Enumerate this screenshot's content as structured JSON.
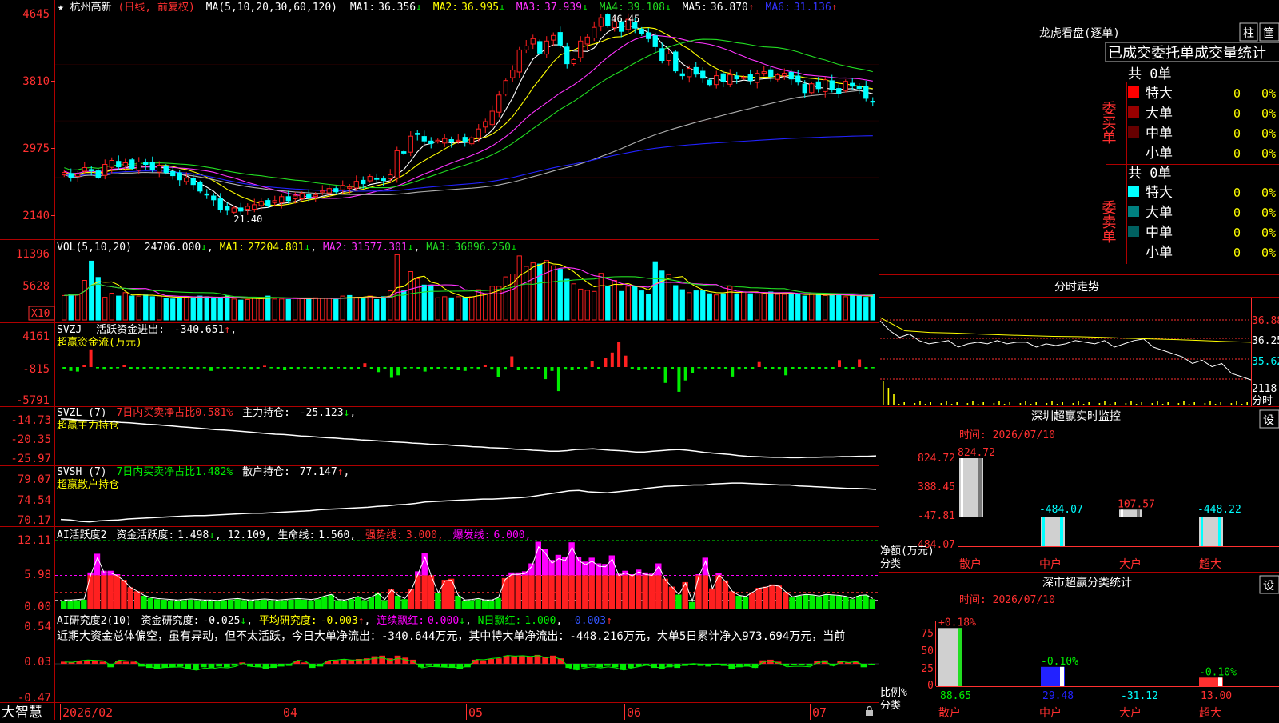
{
  "colors": {
    "bg": "#000000",
    "frame": "#b00000",
    "up": "#ff2020",
    "down": "#00ffff",
    "ma1": "#ffffff",
    "ma2": "#ffff00",
    "ma3": "#ff33ff",
    "ma4": "#22dd22",
    "ma5": "#b0b0b0",
    "ma6": "#2222ff",
    "green": "#00ee00",
    "magenta": "#ff00ff",
    "yellow": "#ffff00",
    "cyan": "#00ffff",
    "white": "#ffffff",
    "red": "#ff3030",
    "gray": "#c0c0c0"
  },
  "price_panel": {
    "star_icon": "★",
    "stock_name": "杭州高新",
    "mode": "(日线, 前复权)",
    "ma_header": "MA(5,10,20,30,60,120)",
    "ma": [
      {
        "label": "MA1:",
        "value": "36.356",
        "arrow": "↓",
        "color": "#ffffff"
      },
      {
        "label": "MA2:",
        "value": "36.995",
        "arrow": "↓",
        "color": "#ffff00"
      },
      {
        "label": "MA3:",
        "value": "37.939",
        "arrow": "↓",
        "color": "#ff33ff"
      },
      {
        "label": "MA4:",
        "value": "39.108",
        "arrow": "↓",
        "color": "#22dd22"
      },
      {
        "label": "MA5:",
        "value": "36.870",
        "arrow": "↑",
        "color": "#ffffff"
      },
      {
        "label": "MA6:",
        "value": "31.136",
        "arrow": "↑",
        "color": "#3333ff"
      }
    ],
    "yticks": [
      "4645",
      "3810",
      "2975",
      "2140"
    ],
    "high_label": "46.45",
    "low_label": "21.40"
  },
  "vol_panel": {
    "header": "VOL(5,10,20)",
    "value": "24706.000",
    "v_arrow": "↓",
    "ma": [
      {
        "label": "MA1:",
        "value": "27204.801",
        "arrow": "↓",
        "color": "#ffff00"
      },
      {
        "label": "MA2:",
        "value": "31577.301",
        "arrow": "↓",
        "color": "#ff33ff"
      },
      {
        "label": "MA3:",
        "value": "36896.250",
        "arrow": "↓",
        "color": "#22dd22"
      }
    ],
    "yticks": [
      "11396",
      "5628"
    ],
    "unit": "X10"
  },
  "svzj_panel": {
    "name": "SVZJ",
    "label": "活跃资金进出:",
    "value": "-340.651",
    "arrow": "↑",
    "sub": "超赢资金流(万元)",
    "yticks": [
      "4161",
      "-815",
      "-5791"
    ]
  },
  "svzl_panel": {
    "name": "SVZL (7)",
    "note": "7日内买卖净占比0.581%",
    "label": "主力持仓:",
    "value": "-25.123",
    "arrow": "↓",
    "sub": "超赢主力持仓",
    "yticks": [
      "-14.73",
      "-20.35",
      "-25.97"
    ]
  },
  "svsh_panel": {
    "name": "SVSH (7)",
    "note": "7日内买卖净占比1.482%",
    "label": "散户持仓:",
    "value": "77.147",
    "arrow": "↑",
    "sub": "超赢散户持仓",
    "yticks": [
      "79.07",
      "74.54",
      "70.17"
    ]
  },
  "ai_panel": {
    "name": "AI活跃度2",
    "l1": "资金活跃度:",
    "v1": "1.498",
    "a1": "↓",
    "v2": "12.109",
    "l3": "生命线:",
    "v3": "1.560",
    "l4": "强势线:",
    "v4": "3.000",
    "l5": "爆发线:",
    "v5": "6.000",
    "yticks": [
      "12.11",
      "5.98",
      "0.00"
    ]
  },
  "ai2_panel": {
    "name": "AI研究度2(10)",
    "l1": "资金研究度:",
    "v1": "-0.025",
    "a1": "↓",
    "l2": "平均研究度:",
    "v2": "-0.003",
    "a2": "↑",
    "l3": "连续飘红:",
    "v3": "0.000",
    "a3": "↓",
    "l4": "N日飘红:",
    "v4": "1.000",
    "v5": "-0.003",
    "a5": "↑",
    "comment": "近期大资金总体偏空，虽有异动，但不太活跃，今日大单净流出：-340.644万元，其中特大单净流出：-448.216万元，大单5日累计净入973.694万元，当前",
    "yticks": [
      "0.54",
      "0.03",
      "-0.47"
    ]
  },
  "bottom_bar": {
    "logo": "大智慧",
    "dates": [
      "2026/02",
      "04",
      "05",
      "06",
      "07"
    ],
    "lock_icon": "lock"
  },
  "dragon": {
    "title": "龙虎看盘(逐单)",
    "btn1": "柱",
    "btn2": "筐",
    "tabs": [
      "已成交",
      "委托单",
      "成交量统计"
    ],
    "buy": {
      "side_label": "委买单",
      "count": "共 0单",
      "rows": [
        {
          "name": "特大",
          "v": "0",
          "p": "0%",
          "color": "#ff0000"
        },
        {
          "name": "大单",
          "v": "0",
          "p": "0%",
          "color": "#990000"
        },
        {
          "name": "中单",
          "v": "0",
          "p": "0%",
          "color": "#660000"
        },
        {
          "name": "小单",
          "v": "0",
          "p": "0%",
          "color": "#000000"
        }
      ]
    },
    "sell": {
      "side_label": "委卖单",
      "count": "共 0单",
      "rows": [
        {
          "name": "特大",
          "v": "0",
          "p": "0%",
          "color": "#00ffff"
        },
        {
          "name": "大单",
          "v": "0",
          "p": "0%",
          "color": "#008080"
        },
        {
          "name": "中单",
          "v": "0",
          "p": "0%",
          "color": "#006060"
        },
        {
          "name": "小单",
          "v": "0",
          "p": "0%",
          "color": "#000000"
        }
      ]
    }
  },
  "intraday": {
    "title": "分时走势",
    "yticks": [
      "36.88",
      "36.25",
      "35.62"
    ],
    "vol_label": "2118",
    "time_unit": "分时"
  },
  "monitor": {
    "title": "深圳超赢实时监控",
    "btn": "设",
    "time": "时间: 2026/07/10",
    "yticks": [
      "824.72",
      "388.45",
      "-47.81",
      "-484.07"
    ],
    "ylabel": "净额(万元)",
    "xlabel": "分类",
    "categories": [
      "散户",
      "中户",
      "大户",
      "超大"
    ],
    "values": [
      "824.72",
      "-484.07",
      "107.57",
      "-448.22"
    ]
  },
  "stat": {
    "title": "深市超赢分类统计",
    "btn": "设",
    "time": "时间: 2026/07/10",
    "yticks": [
      "75",
      "50",
      "25",
      "0"
    ],
    "ylabel": "比例%",
    "xlabel": "分类",
    "categories": [
      "散户",
      "中户",
      "大户",
      "超大"
    ],
    "pcts": [
      "+0.18%",
      "-0.10%",
      "",
      "-0.10%"
    ],
    "values": [
      "88.65",
      "29.48",
      "-31.12",
      "13.00"
    ]
  },
  "chart_data": [
    {
      "type": "candlestick",
      "title": "杭州高新 (日线, 前复权)",
      "x_labels": [
        "2026/02",
        "04",
        "05",
        "06",
        "07"
      ],
      "ylim": [
        21,
        47
      ],
      "series": [
        {
          "name": "MA1"
        },
        {
          "name": "MA2"
        },
        {
          "name": "MA3"
        },
        {
          "name": "MA4"
        },
        {
          "name": "MA5"
        },
        {
          "name": "MA6"
        }
      ],
      "close": [
        26.6,
        26.0,
        26.4,
        27.2,
        26.8,
        26.0,
        27.6,
        28.1,
        27.3,
        27.8,
        27.1,
        27.9,
        27.6,
        27.0,
        27.5,
        26.6,
        26.2,
        25.7,
        25.9,
        25.1,
        24.3,
        23.8,
        23.2,
        22.0,
        21.9,
        22.2,
        21.8,
        22.4,
        22.6,
        23.0,
        22.5,
        23.1,
        23.6,
        23.1,
        23.7,
        24.0,
        23.5,
        23.8,
        24.3,
        24.6,
        24.2,
        25.0,
        24.8,
        25.5,
        25.2,
        26.1,
        25.8,
        25.6,
        26.3,
        29.3,
        29.0,
        31.1,
        31.3,
        30.5,
        30.2,
        30.6,
        30.8,
        30.4,
        30.6,
        30.4,
        30.9,
        32.0,
        32.9,
        34.2,
        36.2,
        38.0,
        39.3,
        41.8,
        42.3,
        43.2,
        41.4,
        42.9,
        43.6,
        42.4,
        40.1,
        40.6,
        42.9,
        43.4,
        44.6,
        45.8,
        44.8,
        45.3,
        44.1,
        45.6,
        44.5,
        43.8,
        43.2,
        42.2,
        40.5,
        41.3,
        39.2,
        38.6,
        39.5,
        38.8,
        38.3,
        37.5,
        38.6,
        37.9,
        38.7,
        38.2,
        38.4,
        38.0,
        38.9,
        39.1,
        38.5,
        38.7,
        38.9,
        38.2,
        37.8,
        36.5,
        37.6,
        37.0,
        38.1,
        36.9,
        36.4,
        37.9,
        37.3,
        37.0,
        35.8,
        35.4
      ],
      "ma_last": [
        36.356,
        36.995,
        37.939,
        39.108,
        36.87,
        31.136
      ],
      "high": 46.45,
      "low": 21.4
    },
    {
      "type": "bar",
      "title": "VOL(5,10,20)",
      "values": [
        4200,
        4400,
        4300,
        6800,
        10100,
        7300,
        3900,
        4600,
        4100,
        4700,
        4100,
        4100,
        4300,
        4000,
        4200,
        3700,
        3600,
        3900,
        4000,
        3800,
        4100,
        4000,
        3700,
        3900,
        4200,
        3600,
        3400,
        3500,
        3800,
        3900,
        4100,
        3600,
        3600,
        3500,
        3800,
        3700,
        3600,
        3800,
        3700,
        3700,
        3500,
        4100,
        4200,
        3900,
        3900,
        4100,
        3500,
        4000,
        5000,
        11200,
        5000,
        8300,
        7100,
        6000,
        6000,
        3800,
        4000,
        3800,
        4000,
        3900,
        4000,
        5200,
        4500,
        5800,
        5800,
        7400,
        7900,
        11000,
        9200,
        9800,
        9600,
        10200,
        9300,
        8700,
        7000,
        6200,
        5300,
        5100,
        4900,
        8000,
        5800,
        6800,
        4900,
        5800,
        5700,
        5000,
        4400,
        10000,
        8400,
        7800,
        5900,
        5200,
        4700,
        5000,
        5000,
        4500,
        4300,
        4500,
        5800,
        4500,
        4800,
        4500,
        4500,
        4700,
        4800,
        4400,
        4400,
        4600,
        4400,
        4100,
        4500,
        4300,
        4200,
        4400,
        4400,
        4000,
        4200,
        4100,
        3900,
        4400
      ]
    },
    {
      "type": "bar",
      "title": "超赢资金流(万元)",
      "values": [
        -300,
        -600,
        -700,
        300,
        2800,
        -200,
        -400,
        -300,
        -200,
        300,
        -300,
        -400,
        -300,
        -200,
        -400,
        -300,
        -200,
        -300,
        -200,
        -300,
        -400,
        -200,
        -600,
        -200,
        -300,
        -200,
        -300,
        -200,
        -400,
        -300,
        200,
        -200,
        -300,
        -500,
        -300,
        -400,
        -200,
        -300,
        -200,
        -400,
        -300,
        -200,
        -300,
        -400,
        -300,
        600,
        -300,
        -800,
        -300,
        -1700,
        -1300,
        -300,
        -200,
        -300,
        -700,
        -400,
        -300,
        -200,
        -300,
        -500,
        -600,
        -200,
        -400,
        300,
        -400,
        -1600,
        -400,
        1700,
        -500,
        -400,
        -300,
        -300,
        -1900,
        -600,
        -3800,
        -400,
        -500,
        -300,
        -400,
        1000,
        -300,
        1400,
        2300,
        4000,
        1800,
        -300,
        -500,
        -400,
        -300,
        -300,
        -2500,
        -300,
        -3900,
        -2100,
        -900,
        -200,
        -400,
        -300,
        -300,
        -300,
        -1500,
        -400,
        -300,
        -300,
        800,
        -300,
        -300,
        -400,
        -1300,
        -300,
        -300,
        -300,
        -300,
        -300,
        -300,
        -300,
        1100,
        -300,
        -300,
        1200,
        -300,
        -200
      ]
    },
    {
      "type": "line",
      "title": "超赢主力持仓",
      "ylim": [
        -25.97,
        -14.73
      ],
      "values": [
        -14.7,
        -14.8,
        -15.0,
        -15.1,
        -15.2,
        -15.4,
        -15.5,
        -15.7,
        -15.8,
        -16.0,
        -16.2,
        -16.3,
        -16.5,
        -16.7,
        -16.9,
        -17.1,
        -17.3,
        -17.5,
        -17.7,
        -17.8,
        -18.0,
        -18.2,
        -18.4,
        -18.6,
        -18.8,
        -19.0,
        -19.1,
        -19.3,
        -19.5,
        -19.6,
        -19.8,
        -20.0,
        -20.1,
        -20.3,
        -20.4,
        -20.6,
        -20.7,
        -20.9,
        -21.0,
        -21.2,
        -21.3,
        -21.5,
        -21.6,
        -21.8,
        -21.9,
        -22.0,
        -22.2,
        -22.3,
        -22.5,
        -22.6,
        -22.8,
        -22.9,
        -23.0,
        -23.2,
        -23.3,
        -23.5,
        -23.6,
        -23.8,
        -23.8,
        -23.6,
        -23.3,
        -23.2,
        -23.1,
        -23.3,
        -23.5,
        -23.6,
        -23.8,
        -24.0,
        -24.0,
        -23.8,
        -23.6,
        -23.4,
        -23.3,
        -23.5,
        -23.8,
        -24.1,
        -24.3,
        -24.5,
        -24.7,
        -25.0,
        -25.2,
        -25.3,
        -25.4,
        -25.5,
        -25.5,
        -25.6,
        -25.6,
        -25.5,
        -25.5,
        -25.4,
        -25.4,
        -25.3,
        -25.3,
        -25.2,
        -25.2,
        -25.1
      ]
    },
    {
      "type": "line",
      "title": "超赢散户持仓",
      "ylim": [
        70.17,
        79.07
      ],
      "values": [
        70.9,
        70.8,
        70.5,
        70.4,
        70.6,
        70.7,
        70.8,
        71.0,
        71.1,
        71.2,
        71.3,
        71.4,
        71.5,
        71.6,
        71.7,
        71.7,
        71.8,
        71.9,
        72.0,
        72.1,
        72.2,
        72.2,
        72.3,
        72.4,
        72.5,
        72.6,
        72.7,
        72.9,
        73.0,
        73.1,
        73.2,
        73.3,
        73.4,
        73.6,
        73.7,
        73.9,
        74.0,
        74.2,
        74.5,
        74.6,
        74.7,
        74.8,
        74.9,
        75.0,
        75.1,
        75.1,
        75.2,
        75.3,
        75.4,
        75.6,
        75.9,
        76.2,
        76.5,
        76.8,
        76.9,
        76.6,
        76.5,
        76.4,
        76.6,
        76.8,
        77.0,
        77.3,
        77.5,
        77.7,
        77.8,
        77.9,
        78.0,
        78.0,
        78.2,
        78.3,
        78.4,
        78.4,
        78.3,
        78.2,
        78.1,
        78.0,
        78.0,
        77.8,
        77.7,
        77.6,
        77.5,
        77.4,
        77.3,
        77.3,
        77.2,
        77.1
      ]
    },
    {
      "type": "bar",
      "title": "AI活跃度2",
      "ylim": [
        0,
        12.11
      ],
      "values": [
        1.5,
        1.5,
        1.6,
        1.7,
        6.5,
        9.8,
        6.8,
        6.8,
        6.2,
        5.2,
        3.9,
        3.2,
        2.4,
        2.0,
        1.8,
        1.7,
        1.6,
        1.5,
        1.6,
        1.7,
        1.6,
        1.5,
        1.5,
        1.4,
        1.6,
        1.7,
        1.8,
        1.6,
        1.5,
        1.6,
        1.7,
        1.6,
        1.5,
        1.6,
        1.7,
        1.8,
        1.7,
        1.6,
        1.8,
        2.3,
        2.6,
        1.6,
        1.5,
        1.8,
        2.2,
        1.6,
        2.1,
        2.8,
        1.6,
        3.5,
        2.4,
        1.8,
        3.6,
        6.7,
        9.9,
        6.0,
        2.9,
        5.2,
        5.4,
        2.4,
        1.5,
        1.6,
        1.8,
        1.5,
        1.5,
        2.0,
        5.5,
        6.5,
        6.5,
        6.7,
        8.1,
        11.9,
        10.7,
        8.7,
        9.6,
        9.2,
        11.8,
        9.2,
        8.4,
        9.1,
        8.1,
        8.0,
        9.5,
        6.3,
        6.8,
        6.2,
        7.0,
        6.5,
        6.3,
        8.1,
        5.4,
        4.0,
        2.6,
        4.8,
        1.3,
        6.2,
        9.1,
        3.7,
        6.4,
        5.1,
        3.2,
        2.4,
        2.2,
        3.0,
        3.8,
        4.0,
        4.4,
        4.2,
        3.1,
        2.1,
        2.4,
        2.6,
        2.5,
        2.3,
        2.6,
        2.5,
        2.4,
        2.2,
        1.8,
        2.4,
        2.5,
        1.8
      ]
    },
    {
      "type": "bar",
      "title": "AI研究度2(10)",
      "ylim": [
        -0.47,
        0.54
      ],
      "values": [
        0.03,
        0.02,
        0.04,
        0.05,
        0.04,
        0.03,
        -0.05,
        0.04,
        0.03,
        0.03,
        -0.04,
        -0.06,
        -0.08,
        -0.06,
        -0.05,
        -0.04,
        -0.07,
        -0.09,
        -0.05,
        -0.06,
        -0.04,
        -0.05,
        -0.03,
        0.02,
        -0.04,
        -0.05,
        -0.07,
        -0.06,
        -0.04,
        -0.03,
        0.04,
        0.02,
        -0.06,
        -0.04,
        0.04,
        0.05,
        0.07,
        0.06,
        0.07,
        0.08,
        0.11,
        0.12,
        0.08,
        0.12,
        0.09,
        0.06,
        -0.05,
        -0.03,
        -0.04,
        -0.05,
        -0.06,
        -0.07,
        -0.05,
        0.06,
        0.05,
        0.07,
        0.08,
        0.12,
        0.11,
        0.12,
        0.11,
        0.13,
        0.1,
        0.12,
        0.08,
        -0.06,
        -0.09,
        -0.05,
        -0.03,
        -0.05,
        -0.03,
        -0.05,
        -0.09,
        -0.06,
        -0.04,
        -0.02,
        -0.06,
        -0.08,
        -0.05,
        -0.06,
        -0.03,
        -0.02,
        -0.03,
        -0.04,
        -0.02,
        -0.03,
        -0.07,
        -0.05,
        -0.04,
        -0.06,
        0.05,
        0.06,
        0.03,
        -0.03,
        -0.02,
        -0.02,
        -0.03,
        0.04,
        0.05,
        -0.03,
        0.04,
        0.02,
        0.03,
        -0.05,
        -0.02
      ]
    },
    {
      "type": "bar",
      "title": "深圳超赢实时监控",
      "categories": [
        "散户",
        "中户",
        "大户",
        "超大"
      ],
      "values": [
        824.72,
        -484.07,
        107.57,
        -448.22
      ],
      "ylim": [
        -484.07,
        824.72
      ]
    },
    {
      "type": "bar",
      "title": "深市超赢分类统计",
      "categories": [
        "散户",
        "中户",
        "大户",
        "超大"
      ],
      "values": [
        88.65,
        29.48,
        -31.12,
        13.0
      ],
      "ylim": [
        0,
        100
      ]
    },
    {
      "type": "line",
      "title": "分时走势",
      "ylim": [
        35.1,
        37.1
      ],
      "values": [
        36.9,
        36.6,
        36.4,
        36.5,
        36.3,
        36.2,
        36.25,
        36.3,
        36.1,
        36.2,
        36.25,
        36.2,
        36.3,
        36.2,
        36.25,
        36.25,
        36.1,
        36.2,
        36.15,
        36.2,
        36.3,
        36.25,
        36.2,
        36.3,
        36.1,
        36.2,
        36.3,
        36.35,
        36.1,
        36.0,
        35.9,
        35.8,
        35.6,
        35.7,
        35.5,
        35.6,
        35.3,
        35.2,
        35.1
      ],
      "avg": [
        37.0,
        36.6,
        36.55,
        36.53,
        36.5,
        36.47,
        36.45,
        36.43,
        36.42,
        36.4,
        36.37,
        36.35,
        36.33,
        36.3,
        36.27,
        36.25
      ]
    }
  ]
}
